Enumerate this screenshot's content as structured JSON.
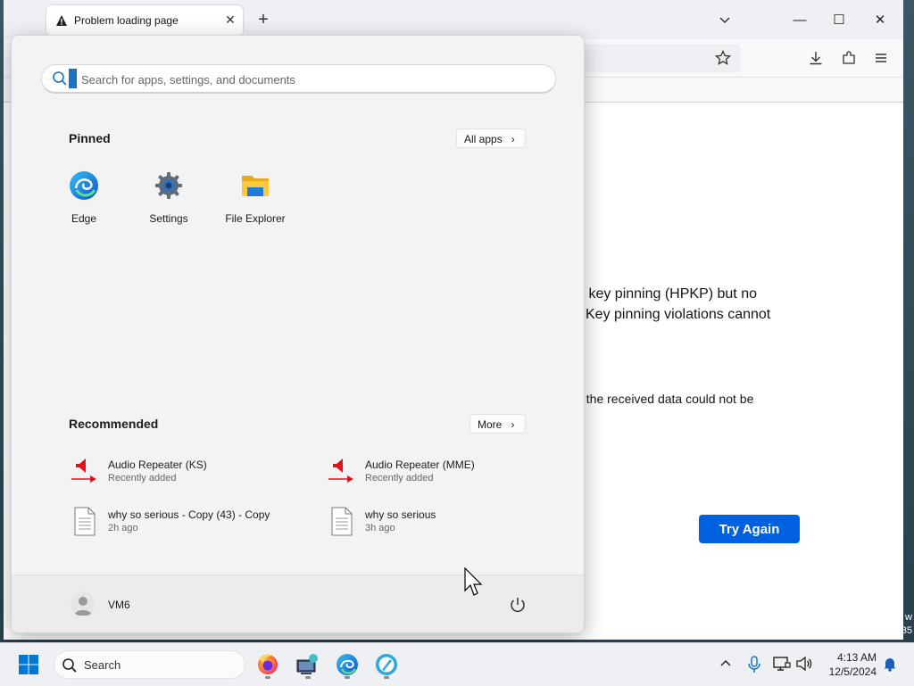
{
  "browser": {
    "tab_title": "Problem loading page",
    "error_lines": [
      "s key pinning (HPKP) but no",
      "Key pinning violations cannot",
      "f the received data could not be"
    ],
    "try_again_label": "Try Again"
  },
  "start_menu": {
    "search_placeholder": "Search for apps, settings, and documents",
    "pinned_title": "Pinned",
    "all_apps_label": "All apps",
    "pinned": [
      {
        "label": "Edge",
        "icon": "edge-icon"
      },
      {
        "label": "Settings",
        "icon": "settings-gear-icon"
      },
      {
        "label": "File Explorer",
        "icon": "folder-icon"
      }
    ],
    "recommended_title": "Recommended",
    "more_label": "More",
    "recommended": [
      {
        "name": "Audio Repeater (KS)",
        "sub": "Recently added",
        "icon": "audio-repeater-icon"
      },
      {
        "name": "Audio Repeater (MME)",
        "sub": "Recently added",
        "icon": "audio-repeater-icon"
      },
      {
        "name": "why so serious - Copy (43) - Copy",
        "sub": "2h ago",
        "icon": "document-icon"
      },
      {
        "name": "why so serious",
        "sub": "3h ago",
        "icon": "document-icon"
      }
    ],
    "user_name": "VM6"
  },
  "taskbar": {
    "search_label": "Search",
    "time": "4:13 AM",
    "date": "12/5/2024"
  },
  "desktop_edge_text": [
    "w",
    "35"
  ],
  "colors": {
    "accent": "#0061e0",
    "windows_blue": "#0078d4"
  }
}
